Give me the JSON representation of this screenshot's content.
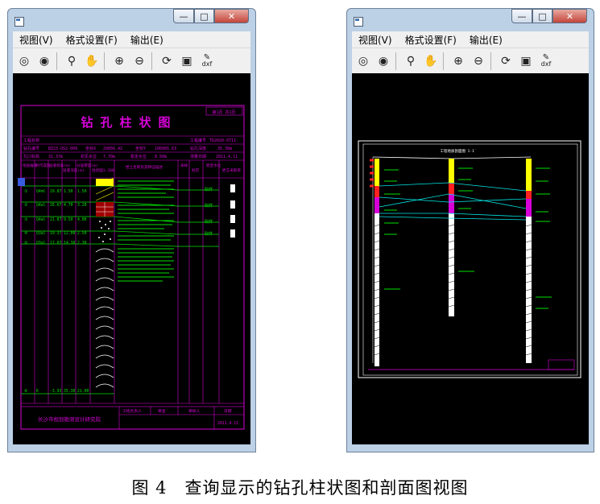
{
  "figure": {
    "caption": "图 4　查询显示的钻孔柱状图和剖面图视图"
  },
  "window_left": {
    "menu": [
      "视图(V)",
      "格式设置(F)",
      "输出(E)"
    ],
    "toolbar_icons": [
      "zoom-extents-icon",
      "zoom-window-icon",
      "zoom-realtime-icon",
      "pan-icon",
      "zoom-in-icon",
      "zoom-out-icon",
      "regen-icon",
      "save-icon",
      "export-dxf-icon"
    ],
    "dxf_label": "dxf",
    "log": {
      "title": "钻 孔 柱 状 图",
      "sheet_label": "第1页 共1页",
      "header_rows": [
        [
          "工程名称",
          "",
          "工程编号",
          "TD2020-0711"
        ],
        [
          "钻孔编号",
          "BZ23-QS2-009",
          "坐标X",
          "29856.42",
          "坐标Y",
          "106065.63",
          "钻孔深度",
          "35.30m"
        ],
        [
          "孔口标高",
          "31.37m",
          "初见水位",
          "7.70m",
          "稳定水位",
          "8.50m",
          "测量日期",
          "2011.4.11"
        ]
      ],
      "column_headers": [
        "地层编号",
        "时代成因",
        "层底标高(m)",
        "层底深度(m)",
        "分层厚度(m)",
        "柱状图1:200",
        "岩土名称及其特征描述",
        "采样",
        "标贯",
        "稳定水位",
        "岩芯采取率"
      ],
      "layers": [
        {
          "id": "①",
          "age": "Q4ml",
          "elev": "29.87",
          "depth": "1.50",
          "thick": "1.50"
        },
        {
          "id": "②",
          "age": "Q4al",
          "elev": "26.67",
          "depth": "4.70",
          "thick": "3.20"
        },
        {
          "id": "③",
          "age": "Q4al",
          "elev": "21.87",
          "depth": "9.50",
          "thick": "4.80"
        },
        {
          "id": "④",
          "age": "Q3al",
          "elev": "19.37",
          "depth": "12.00",
          "thick": "2.50"
        },
        {
          "id": "⑤",
          "age": "Q3al",
          "elev": "17.07",
          "depth": "14.30",
          "thick": "2.30"
        },
        {
          "id": "⑥",
          "age": "K",
          "elev": "-3.93",
          "depth": "35.30",
          "thick": "21.00"
        }
      ],
      "sample_labels": [
        "取样",
        "取样",
        "取样",
        "取样"
      ],
      "institute": "长沙市规划勘测设计研究院",
      "footer_labels": [
        "工程负责人",
        "审查",
        "审核人",
        "日期"
      ],
      "footer_date": "2011.4.11"
    }
  },
  "window_right": {
    "menu": [
      "视图(V)",
      "格式设置(F)",
      "输出(E)"
    ],
    "dxf_label": "dxf",
    "section": {
      "title": "工程地质剖面图 1-1′"
    }
  },
  "colors": {
    "window_frame": "#bcd0e6",
    "grid_magenta": "#d800d8",
    "green": "#00e000",
    "yellow": "#ffff00",
    "cyan": "#00e5e5",
    "white": "#ffffff",
    "red": "#ff2020"
  }
}
